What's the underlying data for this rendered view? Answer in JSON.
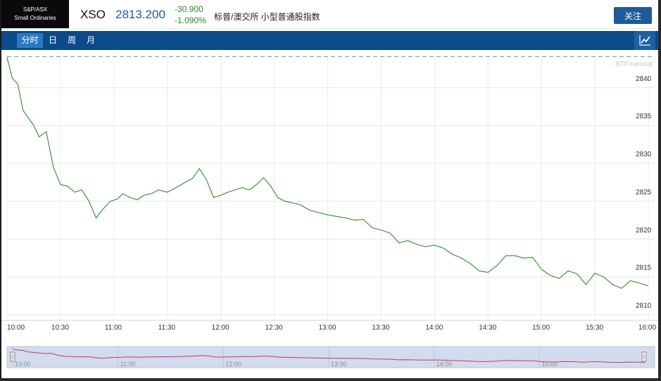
{
  "header": {
    "logo_line1": "S&P/ASX",
    "logo_line2": "Small Ordinaries",
    "symbol": "XSO",
    "price": "2813.200",
    "change": "-30.900",
    "change_pct": "-1.090%",
    "name": "标普/澳交所 小型普通股指数",
    "follow_label": "关注"
  },
  "tabs": [
    {
      "label": "分时",
      "active": true
    },
    {
      "label": "日",
      "active": false
    },
    {
      "label": "周",
      "active": false
    },
    {
      "label": "月",
      "active": false
    }
  ],
  "chart_data": {
    "type": "line",
    "watermark": "BTFinancial",
    "previous_close": 2844.1,
    "x_ticks": [
      "10:00",
      "10:30",
      "11:00",
      "11:30",
      "12:00",
      "12:30",
      "13:00",
      "13:30",
      "14:00",
      "14:30",
      "15:00",
      "15:30",
      "16:00"
    ],
    "y_ticks": [
      2810,
      2815,
      2820,
      2825,
      2830,
      2835,
      2840
    ],
    "ylim": [
      2810,
      2844.5
    ],
    "series": [
      {
        "color": "#2e8b2e",
        "x": [
          "10:00",
          "10:03",
          "10:06",
          "10:09",
          "10:12",
          "10:15",
          "10:18",
          "10:22",
          "10:26",
          "10:30",
          "10:34",
          "10:38",
          "10:42",
          "10:46",
          "10:50",
          "10:54",
          "10:58",
          "11:02",
          "11:05",
          "11:09",
          "11:13",
          "11:17",
          "11:21",
          "11:25",
          "11:30",
          "11:35",
          "11:40",
          "11:44",
          "11:48",
          "11:52",
          "11:56",
          "12:00",
          "12:04",
          "12:08",
          "12:12",
          "12:16",
          "12:20",
          "12:24",
          "12:28",
          "12:32",
          "12:36",
          "12:40",
          "12:45",
          "12:50",
          "12:55",
          "13:00",
          "13:05",
          "13:10",
          "13:15",
          "13:20",
          "13:25",
          "13:30",
          "13:35",
          "13:40",
          "13:45",
          "13:50",
          "13:55",
          "14:00",
          "14:05",
          "14:10",
          "14:15",
          "14:20",
          "14:25",
          "14:30",
          "14:35",
          "14:40",
          "14:45",
          "14:50",
          "14:55",
          "15:00",
          "15:05",
          "15:10",
          "15:15",
          "15:20",
          "15:25",
          "15:30",
          "15:35",
          "15:40",
          "15:45",
          "15:50",
          "15:55",
          "16:00"
        ],
        "values": [
          2844.0,
          2841.2,
          2840.5,
          2837.0,
          2836.0,
          2835.0,
          2833.5,
          2834.2,
          2829.5,
          2827.2,
          2827.0,
          2826.2,
          2826.5,
          2825.0,
          2822.8,
          2824.0,
          2825.0,
          2825.3,
          2826.0,
          2825.5,
          2825.2,
          2825.8,
          2826.0,
          2826.5,
          2826.2,
          2826.8,
          2827.5,
          2828.0,
          2829.3,
          2827.8,
          2825.5,
          2825.8,
          2826.2,
          2826.5,
          2826.8,
          2826.5,
          2827.2,
          2828.1,
          2827.0,
          2825.5,
          2825.0,
          2824.8,
          2824.5,
          2823.8,
          2823.5,
          2823.2,
          2823.0,
          2822.8,
          2822.5,
          2822.6,
          2821.5,
          2821.2,
          2820.8,
          2819.5,
          2819.8,
          2819.3,
          2819.0,
          2819.2,
          2818.8,
          2818.0,
          2817.5,
          2816.8,
          2815.8,
          2815.6,
          2816.5,
          2817.8,
          2817.8,
          2817.5,
          2817.6,
          2816.0,
          2815.2,
          2814.8,
          2815.8,
          2815.4,
          2814.0,
          2815.5,
          2815.0,
          2814.0,
          2813.5,
          2814.5,
          2814.2,
          2813.8
        ]
      }
    ]
  },
  "navigator": {
    "labels": [
      "10:00",
      "11:00",
      "12:00",
      "13:00",
      "14:00",
      "15:00"
    ]
  }
}
